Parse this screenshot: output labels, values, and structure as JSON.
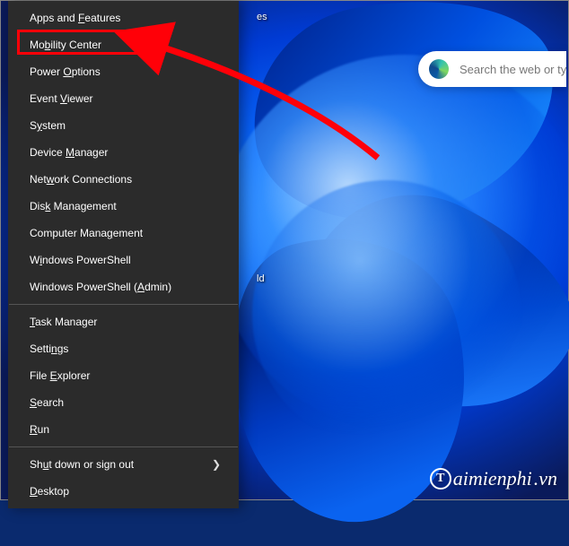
{
  "menu": {
    "items": [
      {
        "label": "Apps and Features",
        "accel": "F"
      },
      {
        "label": "Mobility Center",
        "accel": "B",
        "highlighted": true
      },
      {
        "label": "Power Options",
        "accel": "O"
      },
      {
        "label": "Event Viewer",
        "accel": "V"
      },
      {
        "label": "System",
        "accel": "Y"
      },
      {
        "label": "Device Manager",
        "accel": "M"
      },
      {
        "label": "Network Connections",
        "accel": "W"
      },
      {
        "label": "Disk Management",
        "accel": "K"
      },
      {
        "label": "Computer Management",
        "accel": "G"
      },
      {
        "label": "Windows PowerShell",
        "accel": "I"
      },
      {
        "label": "Windows PowerShell (Admin)",
        "accel": "A"
      }
    ],
    "items2": [
      {
        "label": "Task Manager",
        "accel": "T"
      },
      {
        "label": "Settings",
        "accel": "N"
      },
      {
        "label": "File Explorer",
        "accel": "E"
      },
      {
        "label": "Search",
        "accel": "S"
      },
      {
        "label": "Run",
        "accel": "R"
      }
    ],
    "items3": [
      {
        "label": "Shut down or sign out",
        "accel": "U",
        "submenu": true
      },
      {
        "label": "Desktop",
        "accel": "D"
      }
    ]
  },
  "search": {
    "placeholder": "Search the web or type a"
  },
  "desktop": {
    "icon_fragment_top": "es",
    "icon_fragment_mid": "ld"
  },
  "watermark": {
    "text": "aimienphi",
    "suffix": ".vn",
    "badge": "T"
  },
  "annotation": {
    "highlight_target": "Mobility Center",
    "arrow_color": "#ff0008"
  }
}
